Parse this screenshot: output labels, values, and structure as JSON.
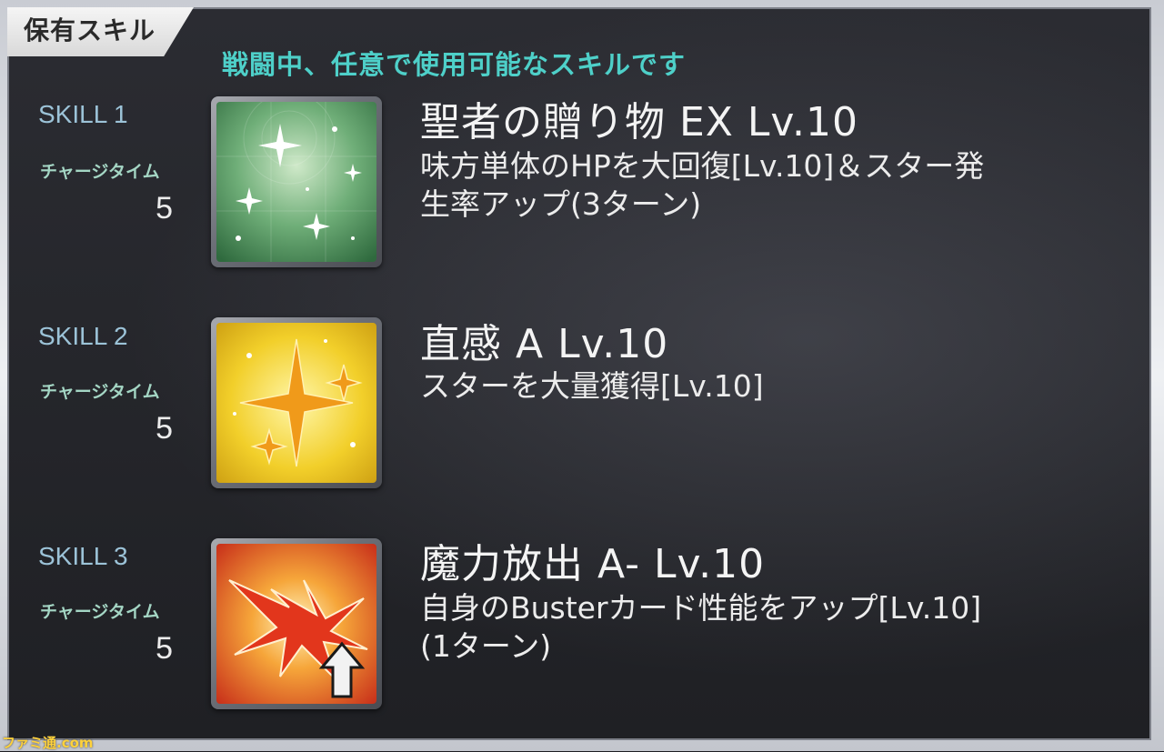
{
  "header": {
    "title": "保有スキル",
    "subtitle": "戦闘中、任意で使用可能なスキルです"
  },
  "skills": [
    {
      "slot_label": "SKILL 1",
      "charge_label": "チャージタイム",
      "charge_value": "5",
      "name": "聖者の贈り物 EX Lv.10",
      "desc_line1": "味方単体のHPを大回復[Lv.10]＆スター発",
      "desc_line2": "生率アップ(3ターン)",
      "icon": "sparkle-heal-icon",
      "icon_color": "#5fa86e"
    },
    {
      "slot_label": "SKILL 2",
      "charge_label": "チャージタイム",
      "charge_value": "5",
      "name": "直感 A Lv.10",
      "desc_line1": "スターを大量獲得[Lv.10]",
      "desc_line2": "",
      "icon": "star-gain-icon",
      "icon_color": "#e8c21f"
    },
    {
      "slot_label": "SKILL 3",
      "charge_label": "チャージタイム",
      "charge_value": "5",
      "name": "魔力放出 A- Lv.10",
      "desc_line1": "自身のBusterカード性能をアップ[Lv.10]",
      "desc_line2": "(1ターン)",
      "icon": "buster-up-icon",
      "icon_color": "#e0461c"
    }
  ],
  "watermark": "ファミ通.com"
}
